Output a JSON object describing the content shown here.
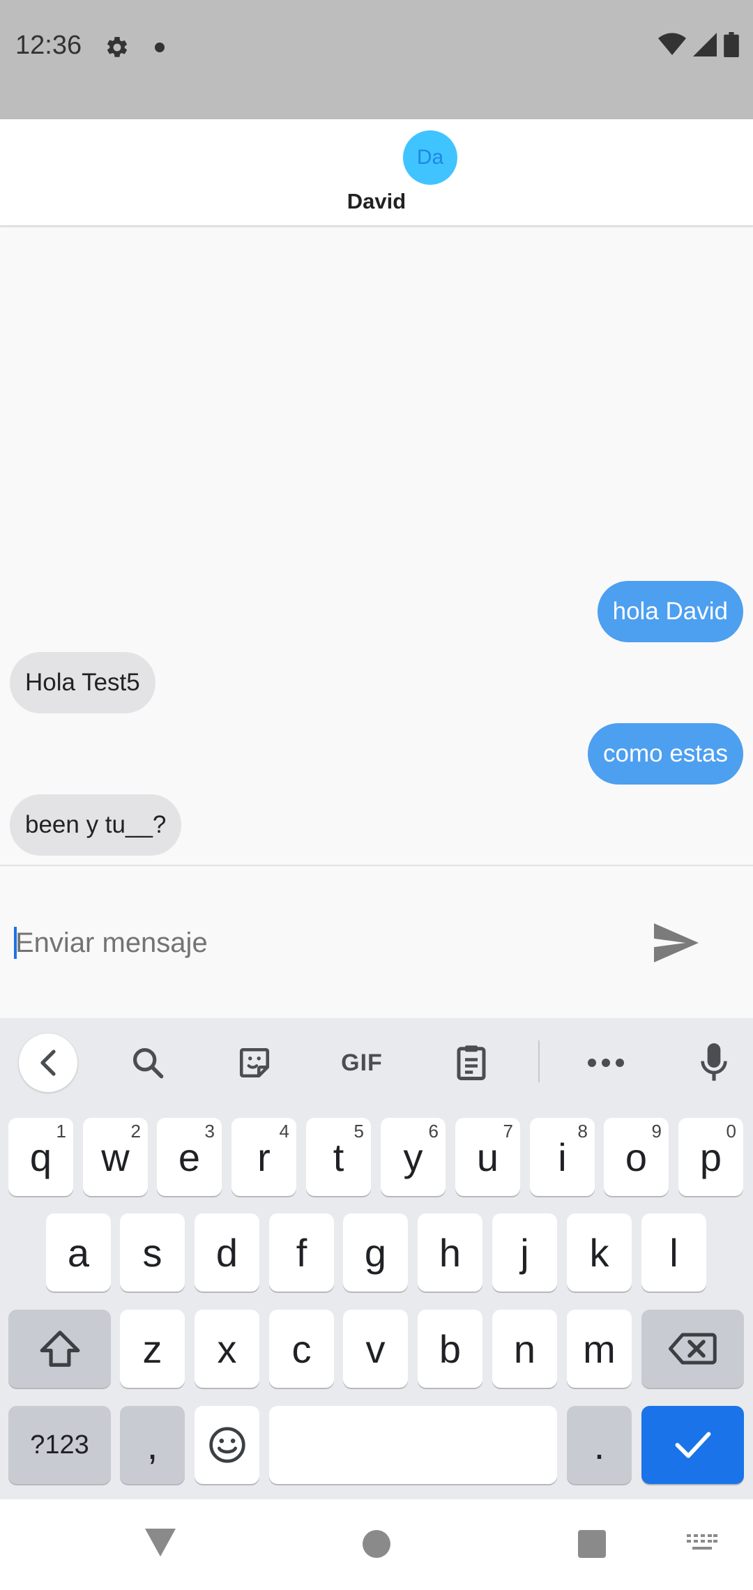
{
  "status_bar": {
    "time": "12:36",
    "icons": [
      "gear-icon",
      "notification-dot-icon",
      "wifi-icon",
      "signal-icon",
      "battery-icon"
    ]
  },
  "header": {
    "avatar_initials": "Da",
    "contact_name": "David",
    "avatar_color": "#40c4ff"
  },
  "messages": [
    {
      "direction": "out",
      "text": "hola David"
    },
    {
      "direction": "in",
      "text": "Hola Test5"
    },
    {
      "direction": "out",
      "text": "como estas"
    },
    {
      "direction": "in",
      "text": "been y tu__?"
    }
  ],
  "composer": {
    "placeholder": "Enviar mensaje",
    "value": ""
  },
  "keyboard": {
    "toolbar": {
      "gif_label": "GIF"
    },
    "row1": [
      {
        "key": "q",
        "hint": "1"
      },
      {
        "key": "w",
        "hint": "2"
      },
      {
        "key": "e",
        "hint": "3"
      },
      {
        "key": "r",
        "hint": "4"
      },
      {
        "key": "t",
        "hint": "5"
      },
      {
        "key": "y",
        "hint": "6"
      },
      {
        "key": "u",
        "hint": "7"
      },
      {
        "key": "i",
        "hint": "8"
      },
      {
        "key": "o",
        "hint": "9"
      },
      {
        "key": "p",
        "hint": "0"
      }
    ],
    "row2": [
      "a",
      "s",
      "d",
      "f",
      "g",
      "h",
      "j",
      "k",
      "l"
    ],
    "row3": [
      "z",
      "x",
      "c",
      "v",
      "b",
      "n",
      "m"
    ],
    "bottom": {
      "symbols_label": "?123",
      "comma": ",",
      "period": "."
    }
  },
  "colors": {
    "outgoing_bubble": "#4d9ff0",
    "incoming_bubble": "#e3e3e6",
    "enter_key": "#1a73e8"
  }
}
